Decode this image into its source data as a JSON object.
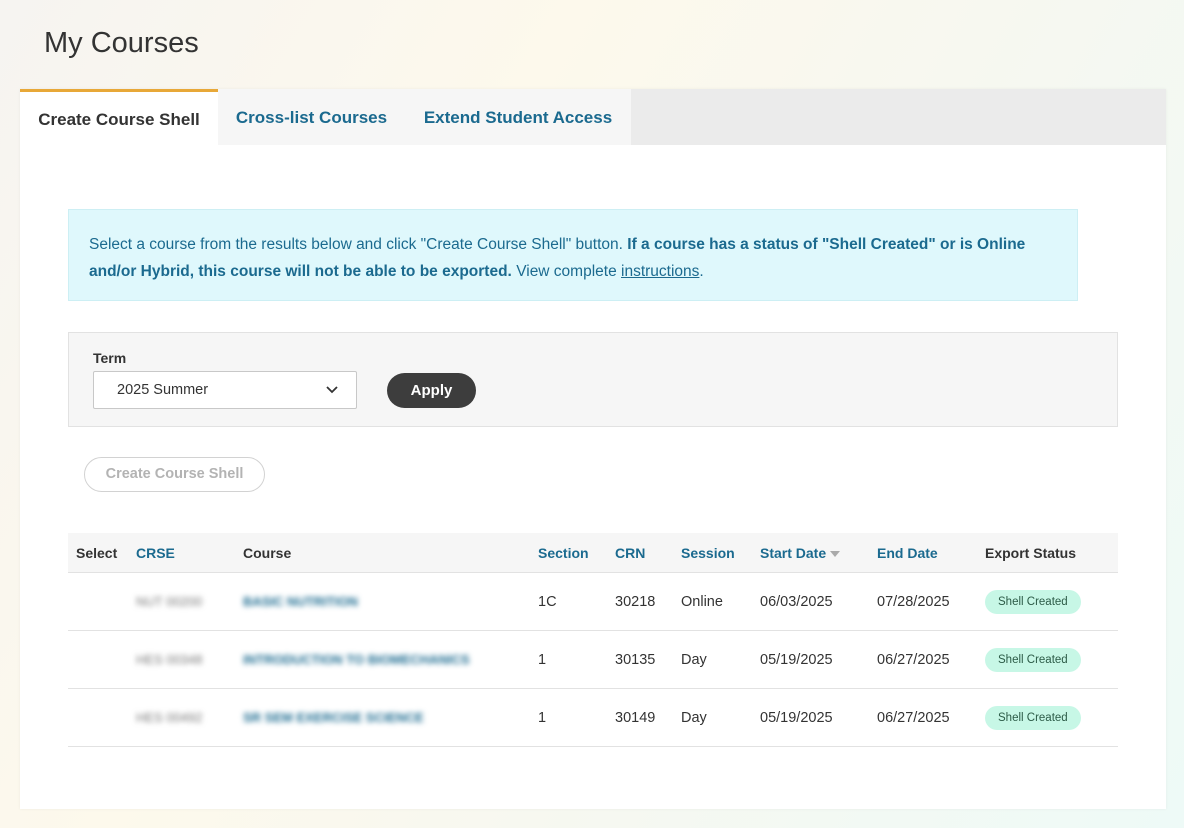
{
  "page": {
    "title": "My Courses"
  },
  "tabs": [
    {
      "label": "Create Course Shell",
      "active": true
    },
    {
      "label": "Cross-list Courses",
      "active": false
    },
    {
      "label": "Extend Student Access",
      "active": false
    }
  ],
  "notice": {
    "text_plain": "Select a course from the results below and click \"Create Course Shell\" button.",
    "text_bold": "If a course has a status of \"Shell Created\" or is Online and/or Hybrid, this course will not be able to be exported.",
    "text_view": "View complete",
    "link_label": "instructions",
    "text_end": "."
  },
  "filter": {
    "term_label": "Term",
    "term_value": "2025 Summer",
    "apply_label": "Apply"
  },
  "actions": {
    "create_shell_label": "Create Course Shell"
  },
  "table": {
    "headers": {
      "select": "Select",
      "crse": "CRSE",
      "course": "Course",
      "section": "Section",
      "crn": "CRN",
      "session": "Session",
      "start_date": "Start Date",
      "end_date": "End Date",
      "export_status": "Export Status"
    },
    "sort": {
      "column": "start_date",
      "direction": "descending"
    },
    "rows": [
      {
        "crse": "NUT 00200",
        "course": "BASIC NUTRITION",
        "section": "1C",
        "crn": "30218",
        "session": "Online",
        "start": "06/03/2025",
        "end": "07/28/2025",
        "status": "Shell Created"
      },
      {
        "crse": "HES 00348",
        "course": "INTRODUCTION TO BIOMECHANICS",
        "section": "1",
        "crn": "30135",
        "session": "Day",
        "start": "05/19/2025",
        "end": "06/27/2025",
        "status": "Shell Created"
      },
      {
        "crse": "HES 00492",
        "course": "SR SEM EXERCISE SCIENCE",
        "section": "1",
        "crn": "30149",
        "session": "Day",
        "start": "05/19/2025",
        "end": "06/27/2025",
        "status": "Shell Created"
      }
    ]
  },
  "colors": {
    "accent_tab": "#e8a838",
    "link": "#1b6a8f",
    "notice_bg": "#dff8fc",
    "badge_bg": "#c7f7e6",
    "apply_bg": "#3d3d3d"
  }
}
